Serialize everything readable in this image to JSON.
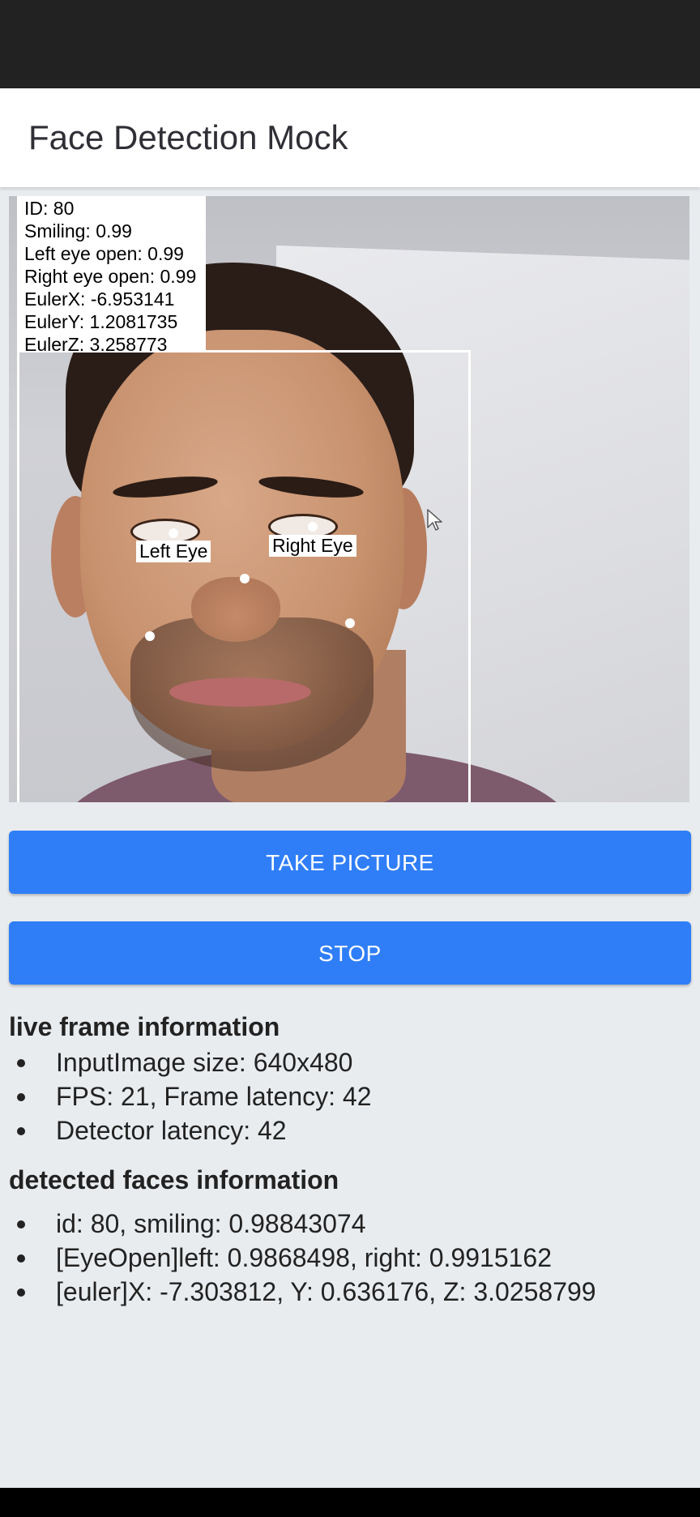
{
  "app_bar": {
    "title": "Face Detection Mock"
  },
  "preview": {
    "overlay_info": [
      "ID: 80",
      "Smiling: 0.99",
      "Left eye open: 0.99",
      "Right eye open: 0.99",
      "EulerX: -6.953141",
      "EulerY: 1.2081735",
      "EulerZ: 3.258773"
    ],
    "landmark_labels": {
      "left_eye": "Left Eye",
      "right_eye": "Right Eye"
    }
  },
  "buttons": {
    "take_picture": "TAKE PICTURE",
    "stop": "STOP"
  },
  "live_frame": {
    "title": "live frame information",
    "items": [
      "InputImage size: 640x480",
      "FPS: 21, Frame latency: 42",
      "Detector latency: 42"
    ]
  },
  "detected_faces": {
    "title": "detected faces information",
    "items": [
      "id: 80, smiling: 0.98843074",
      "[EyeOpen]left: 0.9868498, right: 0.9915162",
      "[euler]X: -7.303812, Y: 0.636176, Z: 3.0258799"
    ]
  },
  "colors": {
    "accent": "#2f7ef8",
    "status_bar": "#222222",
    "background": "#e9ecef"
  }
}
